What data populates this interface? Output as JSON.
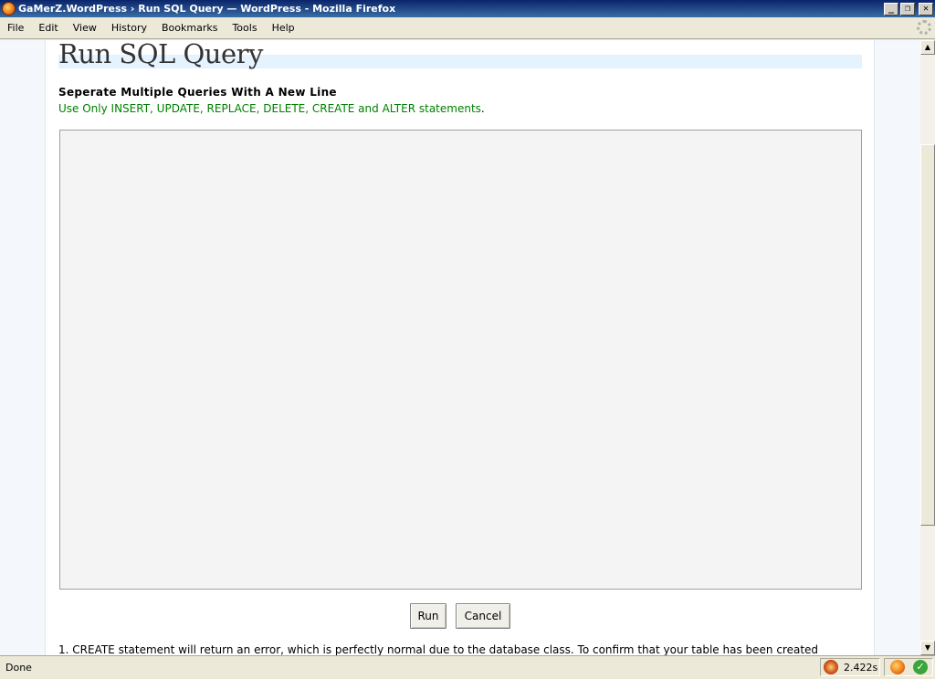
{
  "window": {
    "title": "GaMerZ.WordPress › Run SQL Query — WordPress - Mozilla Firefox",
    "minimize": "_",
    "maximize": "❐",
    "close": "✕"
  },
  "menu": {
    "items": [
      "File",
      "Edit",
      "View",
      "History",
      "Bookmarks",
      "Tools",
      "Help"
    ]
  },
  "page": {
    "title": "Run SQL Query",
    "note_bold": "Seperate Multiple Queries With A New Line",
    "note_green": "Use Only INSERT, UPDATE, REPLACE, DELETE, CREATE and ALTER statements",
    "note_green_end": ".",
    "textarea_value": "",
    "run_label": "Run",
    "cancel_label": "Cancel",
    "footnote": "1. CREATE statement will return an error, which is perfectly normal due to the database class. To confirm that your table has been created"
  },
  "scrollbar": {
    "up": "▲",
    "down": "▼"
  },
  "status": {
    "text": "Done",
    "load_time": "2.422s",
    "check": "✓"
  }
}
